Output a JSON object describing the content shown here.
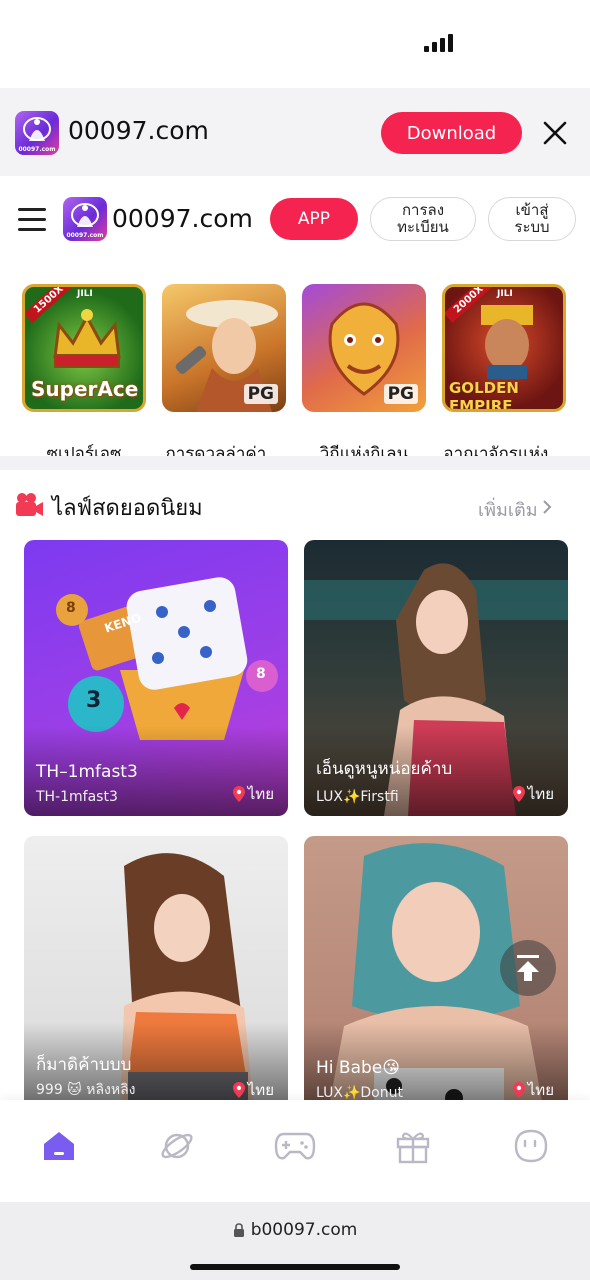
{
  "banner": {
    "logo_text": "00097.com",
    "title": "00097.com",
    "download_label": "Download"
  },
  "header": {
    "logo_text": "00097.com",
    "title": "00097.com",
    "app_label": "APP",
    "register_label": "การลง\nทะเบียน",
    "login_label": "เข้าสู่\nระบบ"
  },
  "games": [
    {
      "label": "ซูเปอร์เอซ",
      "thumb_title": "SuperAce",
      "provider": "JILI",
      "multiplier": "1500X"
    },
    {
      "label": "การดวลล่าค่า...",
      "provider": "PG"
    },
    {
      "label": "วิถีแห่งกิเลน",
      "provider": "PG"
    },
    {
      "label": "อาณาจักรแห่ง...",
      "thumb_title": "GOLDEN EMPIRE",
      "provider": "JILI",
      "multiplier": "2000X"
    }
  ],
  "live_section": {
    "title": "ไลฟ์สดยอดนิยม",
    "more_label": "เพิ่มเติม"
  },
  "live_cards": [
    {
      "name": "TH–1mfast3",
      "sub": "TH-1mfast3",
      "location": "ไทย",
      "thumb_text": "KENO",
      "ball_1": "3",
      "ball_2": "8",
      "ball_3": "8"
    },
    {
      "name": "เอ็นดูหนูหน่อยค้าบ",
      "sub": "LUX✨Firstfi",
      "location": "ไทย"
    },
    {
      "name": "ก็มาดิค้าบบบ",
      "sub": "999 🐱 หลิงหลิง",
      "location": "ไทย"
    },
    {
      "name": "Hi Babe😘",
      "sub": "LUX✨Donut",
      "location": "ไทย"
    }
  ],
  "url_bar": {
    "url": "b00097.com"
  },
  "colors": {
    "accent": "#f5234f",
    "tab_active": "#7b5cf0",
    "tab_inactive": "#b9b9c6"
  },
  "icons": {
    "banner_close": "close-icon",
    "menu": "hamburger-icon",
    "section": "video-camera-icon",
    "scroll_top": "arrow-up-to-line-icon",
    "tabs": [
      "home-icon",
      "planet-icon",
      "gamepad-icon",
      "gift-icon",
      "smiley-icon"
    ]
  }
}
